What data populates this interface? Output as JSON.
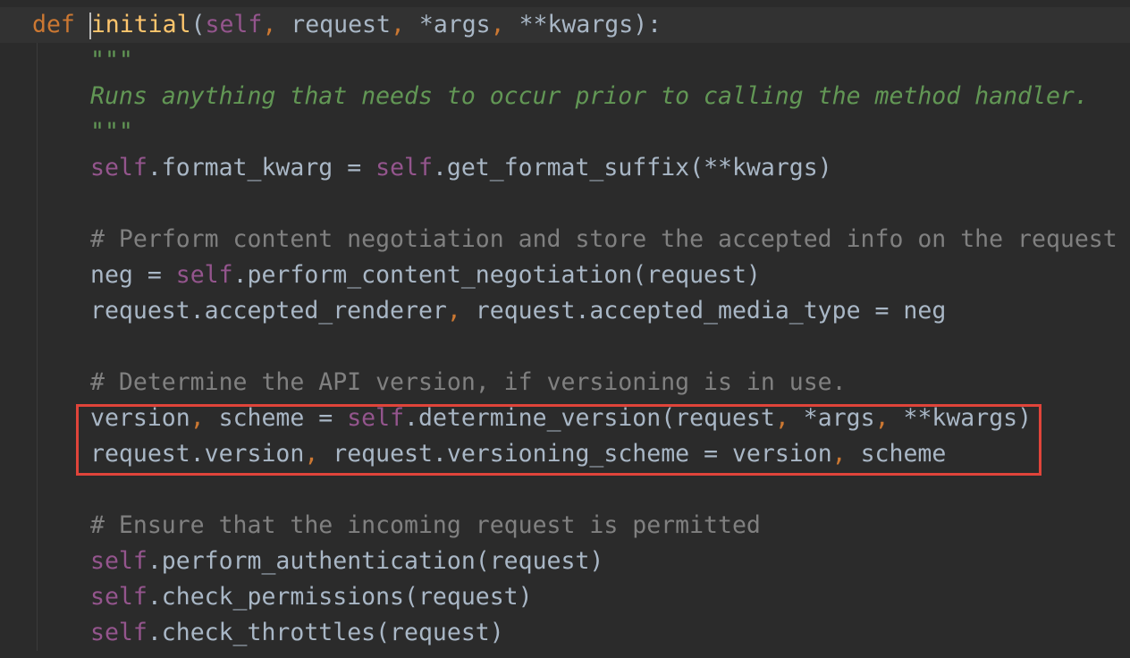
{
  "editor": {
    "lines": [
      {
        "parts": [
          {
            "t": "def",
            "c": "kw"
          },
          {
            "t": " ",
            "c": "plain"
          },
          {
            "t": "initial",
            "c": "fn"
          },
          {
            "t": "(",
            "c": "plain"
          },
          {
            "t": "self",
            "c": "self"
          },
          {
            "t": ", ",
            "c": "punc"
          },
          {
            "t": "request",
            "c": "plain"
          },
          {
            "t": ", ",
            "c": "punc"
          },
          {
            "t": "*args",
            "c": "plain"
          },
          {
            "t": ", ",
            "c": "punc"
          },
          {
            "t": "**kwargs",
            "c": "plain"
          },
          {
            "t": "):",
            "c": "plain"
          }
        ]
      },
      {
        "parts": [
          {
            "t": "\"\"\"",
            "c": "doc"
          }
        ]
      },
      {
        "parts": [
          {
            "t": "Runs anything that needs to occur prior to calling the method handler.",
            "c": "doc"
          }
        ]
      },
      {
        "parts": [
          {
            "t": "\"\"\"",
            "c": "doc"
          }
        ]
      },
      {
        "parts": [
          {
            "t": "self",
            "c": "self"
          },
          {
            "t": ".format_kwarg = ",
            "c": "plain"
          },
          {
            "t": "self",
            "c": "self"
          },
          {
            "t": ".get_format_suffix(**kwargs)",
            "c": "plain"
          }
        ]
      },
      {
        "parts": []
      },
      {
        "parts": [
          {
            "t": "# Perform content negotiation and store the accepted info on the request",
            "c": "cmt"
          }
        ]
      },
      {
        "parts": [
          {
            "t": "neg = ",
            "c": "plain"
          },
          {
            "t": "self",
            "c": "self"
          },
          {
            "t": ".perform_content_negotiation(request)",
            "c": "plain"
          }
        ]
      },
      {
        "parts": [
          {
            "t": "request.accepted_renderer",
            "c": "plain"
          },
          {
            "t": ", ",
            "c": "punc"
          },
          {
            "t": "request.accepted_media_type = neg",
            "c": "plain"
          }
        ]
      },
      {
        "parts": []
      },
      {
        "parts": [
          {
            "t": "# Determine the API version, if versioning is in use.",
            "c": "cmt"
          }
        ]
      },
      {
        "parts": [
          {
            "t": "version",
            "c": "plain"
          },
          {
            "t": ", ",
            "c": "punc"
          },
          {
            "t": "scheme = ",
            "c": "plain"
          },
          {
            "t": "self",
            "c": "self"
          },
          {
            "t": ".determine_version(request",
            "c": "plain"
          },
          {
            "t": ", ",
            "c": "punc"
          },
          {
            "t": "*args",
            "c": "plain"
          },
          {
            "t": ", ",
            "c": "punc"
          },
          {
            "t": "**kwargs)",
            "c": "plain"
          }
        ]
      },
      {
        "parts": [
          {
            "t": "request.version",
            "c": "plain"
          },
          {
            "t": ", ",
            "c": "punc"
          },
          {
            "t": "request.versioning_scheme = version",
            "c": "plain"
          },
          {
            "t": ", ",
            "c": "punc"
          },
          {
            "t": "scheme",
            "c": "plain"
          }
        ]
      },
      {
        "parts": []
      },
      {
        "parts": [
          {
            "t": "# Ensure that the incoming request is permitted",
            "c": "cmt"
          }
        ]
      },
      {
        "parts": [
          {
            "t": "self",
            "c": "self"
          },
          {
            "t": ".perform_authentication(request)",
            "c": "plain"
          }
        ]
      },
      {
        "parts": [
          {
            "t": "self",
            "c": "self"
          },
          {
            "t": ".check_permissions(request)",
            "c": "plain"
          }
        ]
      },
      {
        "parts": [
          {
            "t": "self",
            "c": "self"
          },
          {
            "t": ".check_throttles(request)",
            "c": "plain"
          }
        ]
      }
    ],
    "colors": {
      "background": "#2b2b2b",
      "keyword": "#cc7832",
      "function": "#ffc66d",
      "self": "#94558d",
      "docstring": "#629755",
      "comment": "#808080",
      "text": "#a9b7c6",
      "highlight_box": "#e0443a"
    }
  }
}
